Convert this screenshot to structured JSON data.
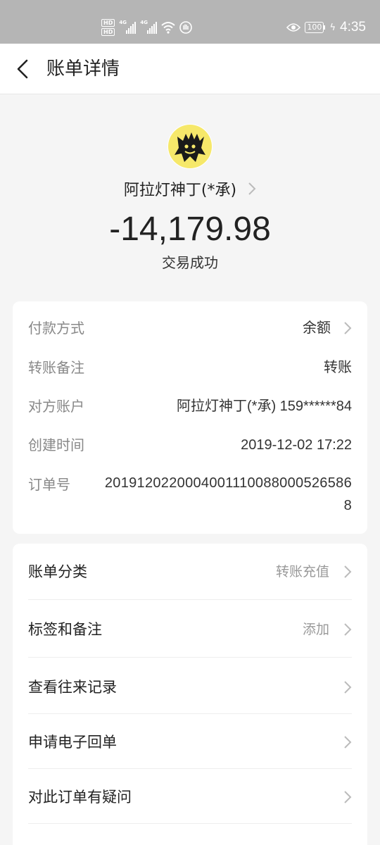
{
  "status_bar": {
    "network_badges": [
      "HD",
      "HD"
    ],
    "signal_labels": [
      "4G",
      "4G"
    ],
    "battery": "100",
    "time": "4:35",
    "icons": [
      "hd-icon",
      "signal-icon",
      "wifi-icon",
      "hand-icon",
      "eye-icon",
      "battery-icon",
      "charging-icon"
    ]
  },
  "nav": {
    "title": "账单详情"
  },
  "header": {
    "payee": "阿拉灯神丁(*承)",
    "amount": "-14,179.98",
    "status": "交易成功"
  },
  "details": [
    {
      "label": "付款方式",
      "value": "余额",
      "has_chevron": true
    },
    {
      "label": "转账备注",
      "value": "转账",
      "has_chevron": false
    },
    {
      "label": "对方账户",
      "value": "阿拉灯神丁(*承) 159******84",
      "has_chevron": false
    },
    {
      "label": "创建时间",
      "value": "2019-12-02 17:22",
      "has_chevron": false
    },
    {
      "label": "订单号",
      "value": "20191202200040011100880005265868",
      "has_chevron": false
    }
  ],
  "actions": [
    {
      "label": "账单分类",
      "value": "转账充值"
    },
    {
      "label": "标签和备注",
      "value": "添加"
    },
    {
      "label": "查看往来记录",
      "value": ""
    },
    {
      "label": "申请电子回单",
      "value": ""
    },
    {
      "label": "对此订单有疑问",
      "value": ""
    }
  ],
  "colors": {
    "status_bar": "#b5b5b5",
    "page_background": "#f5f5f5",
    "card": "#ffffff",
    "label": "#888888",
    "secondary_value": "#999999",
    "primary_text": "#222222"
  }
}
